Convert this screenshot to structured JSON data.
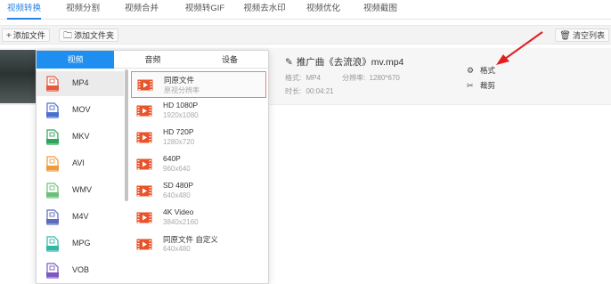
{
  "top_tabs": [
    "视频转换",
    "视频分割",
    "视频合并",
    "视频转GIF",
    "视频去水印",
    "视频优化",
    "视频截图"
  ],
  "toolbar": {
    "add_file": "添加文件",
    "add_folder": "添加文件夹",
    "clear_list": "清空列表"
  },
  "file": {
    "name": "推广曲《去流浪》mv.mp4",
    "format_label": "格式:",
    "format_value": "MP4",
    "resolution_label": "分辨率:",
    "resolution_value": "1280*670",
    "duration_label": "时长:",
    "duration_value": "00:04:21",
    "action_format": "格式",
    "action_cut": "裁剪"
  },
  "panel": {
    "tabs": [
      "视频",
      "音频",
      "设备"
    ],
    "formats": [
      "MP4",
      "MOV",
      "MKV",
      "AVI",
      "WMV",
      "M4V",
      "MPG",
      "VOB"
    ],
    "format_colors": [
      "#e9573f",
      "#4a6fd0",
      "#2fa35a",
      "#f09a3a",
      "#6cc07a",
      "#5c6bc0",
      "#2eb8a6",
      "#7e57c2"
    ],
    "presets": [
      {
        "name": "同原文件",
        "desc": "原视分辨率"
      },
      {
        "name": "HD 1080P",
        "desc": "1920x1080"
      },
      {
        "name": "HD 720P",
        "desc": "1280x720"
      },
      {
        "name": "640P",
        "desc": "960x640"
      },
      {
        "name": "SD 480P",
        "desc": "640x480"
      },
      {
        "name": "4K Video",
        "desc": "3840x2160"
      },
      {
        "name": "同原文件 自定义",
        "desc": "640x480"
      }
    ]
  }
}
